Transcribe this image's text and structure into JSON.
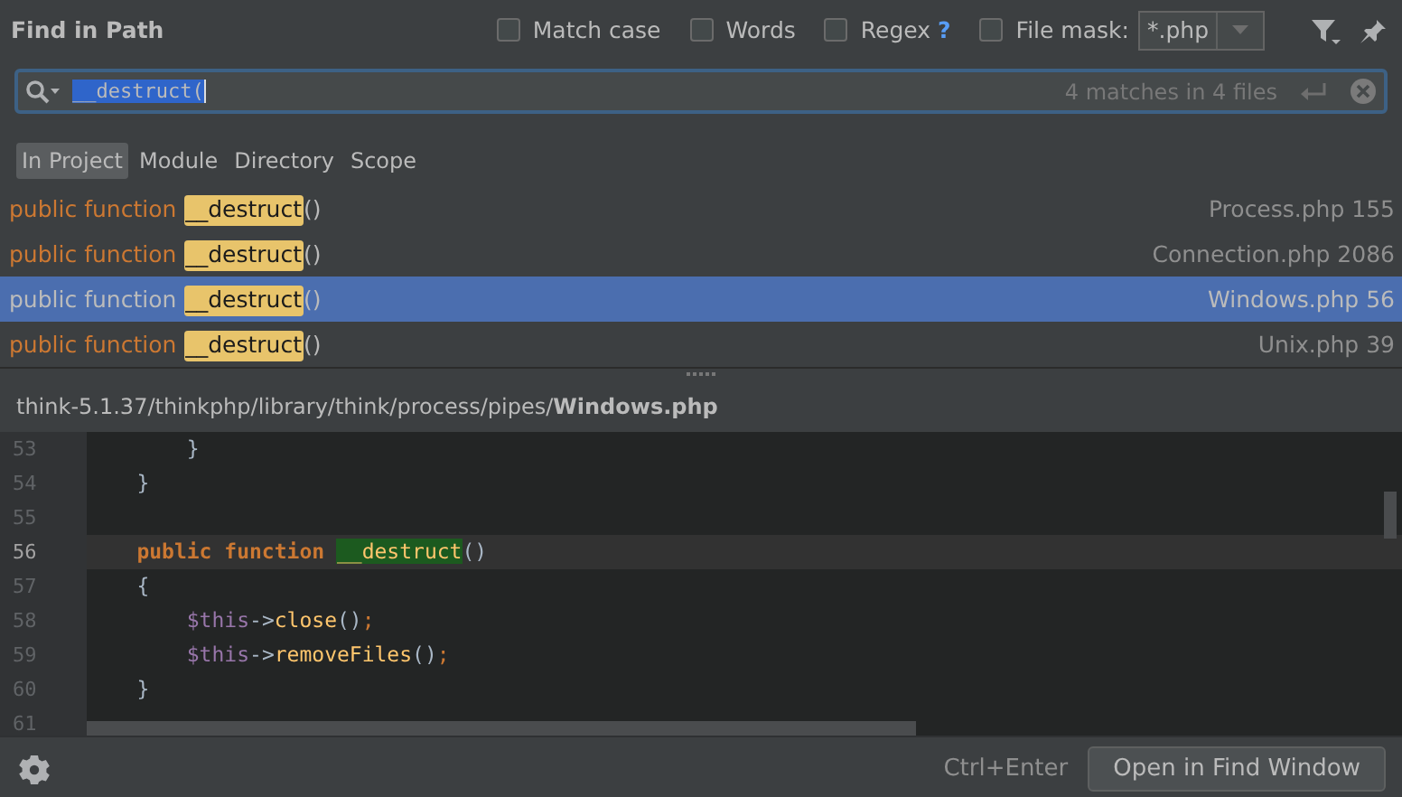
{
  "title": "Find in Path",
  "options": [
    {
      "label": "Match case",
      "checked": false
    },
    {
      "label": "Words",
      "checked": false
    },
    {
      "label": "Regex",
      "checked": false,
      "help": "?"
    },
    {
      "label": "File mask:",
      "checked": false,
      "value": "*.php"
    }
  ],
  "search": {
    "value": "__destruct(",
    "status": "4 matches in 4 files"
  },
  "scopes": [
    {
      "label": "In Project",
      "selected": true
    },
    {
      "label": "Module",
      "selected": false
    },
    {
      "label": "Directory",
      "selected": false
    },
    {
      "label": "Scope",
      "selected": false
    }
  ],
  "results": [
    {
      "prefix": "public function",
      "match": "__destruct",
      "suffix": "()",
      "location": "Process.php 155",
      "selected": false
    },
    {
      "prefix": "public function",
      "match": "__destruct",
      "suffix": "()",
      "location": "Connection.php 2086",
      "selected": false
    },
    {
      "prefix": "public function",
      "match": "__destruct",
      "suffix": "()",
      "location": "Windows.php 56",
      "selected": true
    },
    {
      "prefix": "public function",
      "match": "__destruct",
      "suffix": "()",
      "location": "Unix.php 39",
      "selected": false
    }
  ],
  "preview": {
    "path": "think-5.1.37/thinkphp/library/think/process/pipes/",
    "file": "Windows.php",
    "lines": [
      {
        "number": "53",
        "current": false,
        "tokens": [
          {
            "kind": "plain",
            "text": "        }"
          }
        ]
      },
      {
        "number": "54",
        "current": false,
        "tokens": [
          {
            "kind": "plain",
            "text": "    }"
          }
        ]
      },
      {
        "number": "55",
        "current": false
      },
      {
        "number": "56",
        "current": true,
        "tokens": [
          {
            "kind": "keyword",
            "text": "    public function "
          },
          {
            "kind": "match",
            "text": "__destruct"
          },
          {
            "kind": "plain",
            "text": "()"
          }
        ]
      },
      {
        "number": "57",
        "current": false,
        "tokens": [
          {
            "kind": "plain",
            "text": "    {"
          }
        ]
      },
      {
        "number": "58",
        "current": false,
        "tokens": [
          {
            "kind": "var",
            "text": "        $this"
          },
          {
            "kind": "plain",
            "text": "->"
          },
          {
            "kind": "func",
            "text": "close"
          },
          {
            "kind": "plain",
            "text": "()"
          },
          {
            "kind": "semi",
            "text": ";"
          }
        ]
      },
      {
        "number": "59",
        "current": false,
        "tokens": [
          {
            "kind": "var",
            "text": "        $this"
          },
          {
            "kind": "plain",
            "text": "->"
          },
          {
            "kind": "func",
            "text": "removeFiles"
          },
          {
            "kind": "plain",
            "text": "()"
          },
          {
            "kind": "semi",
            "text": ";"
          }
        ]
      },
      {
        "number": "60",
        "current": false,
        "tokens": [
          {
            "kind": "plain",
            "text": "    }"
          }
        ]
      },
      {
        "number": "61",
        "current": false
      }
    ]
  },
  "footer": {
    "shortcut": "Ctrl+Enter",
    "button": "Open in Find Window"
  }
}
